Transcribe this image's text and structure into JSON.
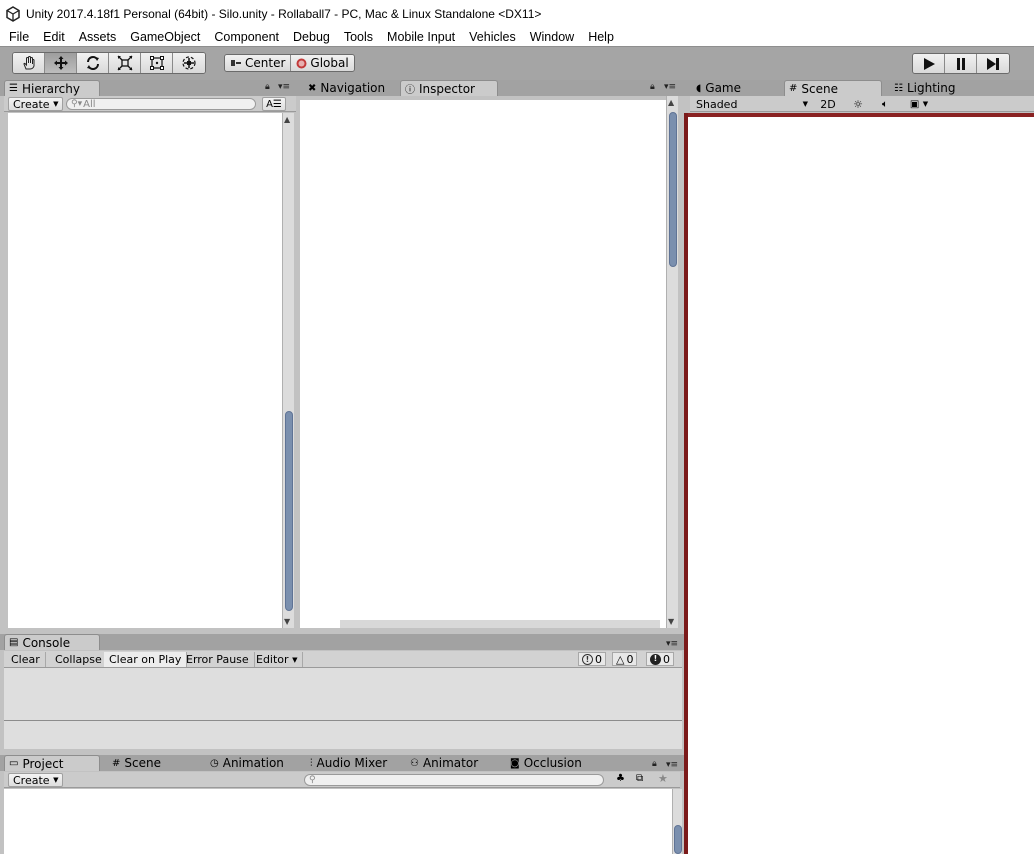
{
  "window": {
    "title": "Unity 2017.4.18f1 Personal (64bit) - Silo.unity - Rollaball7 - PC, Mac & Linux Standalone <DX11>"
  },
  "menu": [
    "File",
    "Edit",
    "Assets",
    "GameObject",
    "Component",
    "Debug",
    "Tools",
    "Mobile Input",
    "Vehicles",
    "Window",
    "Help"
  ],
  "toolbar": {
    "tools": [
      "hand-tool-icon",
      "move-tool-icon",
      "rotate-tool-icon",
      "scale-tool-icon",
      "rect-tool-icon",
      "transform-tool-icon"
    ],
    "active_tool": "move-tool-icon",
    "pivot_label": "Center",
    "space_label": "Global"
  },
  "hierarchy": {
    "tab": "Hierarchy",
    "create_label": "Create",
    "search_placeholder": "All"
  },
  "inspector_panel": {
    "tabs": [
      "Navigation",
      "Inspector"
    ],
    "active_tab": "Inspector"
  },
  "scene_panel": {
    "tabs": [
      "Game",
      "Scene",
      "Lighting"
    ],
    "active_tab": "Scene",
    "shading_mode": "Shaded",
    "mode_2d": "2D"
  },
  "console": {
    "tab": "Console",
    "buttons": [
      "Clear",
      "Collapse",
      "Clear on Play",
      "Error Pause",
      "Editor"
    ],
    "active_buttons": [
      "Clear on Play"
    ],
    "info_count": "0",
    "warning_count": "0",
    "error_count": "0"
  },
  "project": {
    "tabs": [
      "Project",
      "Scene",
      "Animation",
      "Audio Mixer",
      "Animator",
      "Occlusion"
    ],
    "active_tab": "Project",
    "create_label": "Create"
  }
}
